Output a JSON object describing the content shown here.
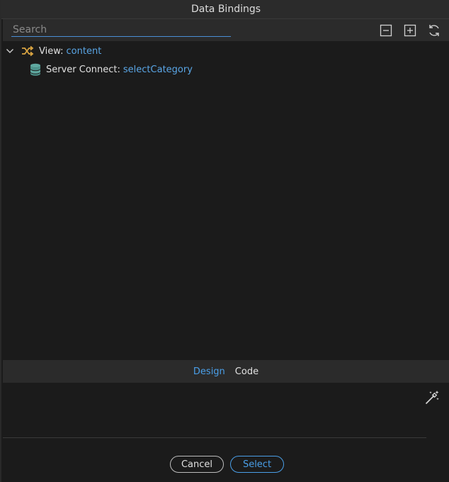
{
  "window": {
    "title": "Data Bindings"
  },
  "search": {
    "placeholder": "Search"
  },
  "toolbar": {
    "icons": [
      "collapse-all-icon",
      "expand-all-icon",
      "refresh-icon"
    ]
  },
  "tree": {
    "items": [
      {
        "key": "View:",
        "value": "content",
        "icon": "shuffle-icon",
        "expanded": true
      },
      {
        "key": "Server Connect:",
        "value": "selectCategory",
        "icon": "database-icon"
      }
    ]
  },
  "tabs": [
    {
      "label": "Design",
      "active": true
    },
    {
      "label": "Code",
      "active": false
    }
  ],
  "footer": {
    "cancel_label": "Cancel",
    "select_label": "Select"
  },
  "colors": {
    "accent": "#4a9fe8",
    "shuffle_icon": "#d9a441",
    "database_icon": "#5fa8a0"
  }
}
